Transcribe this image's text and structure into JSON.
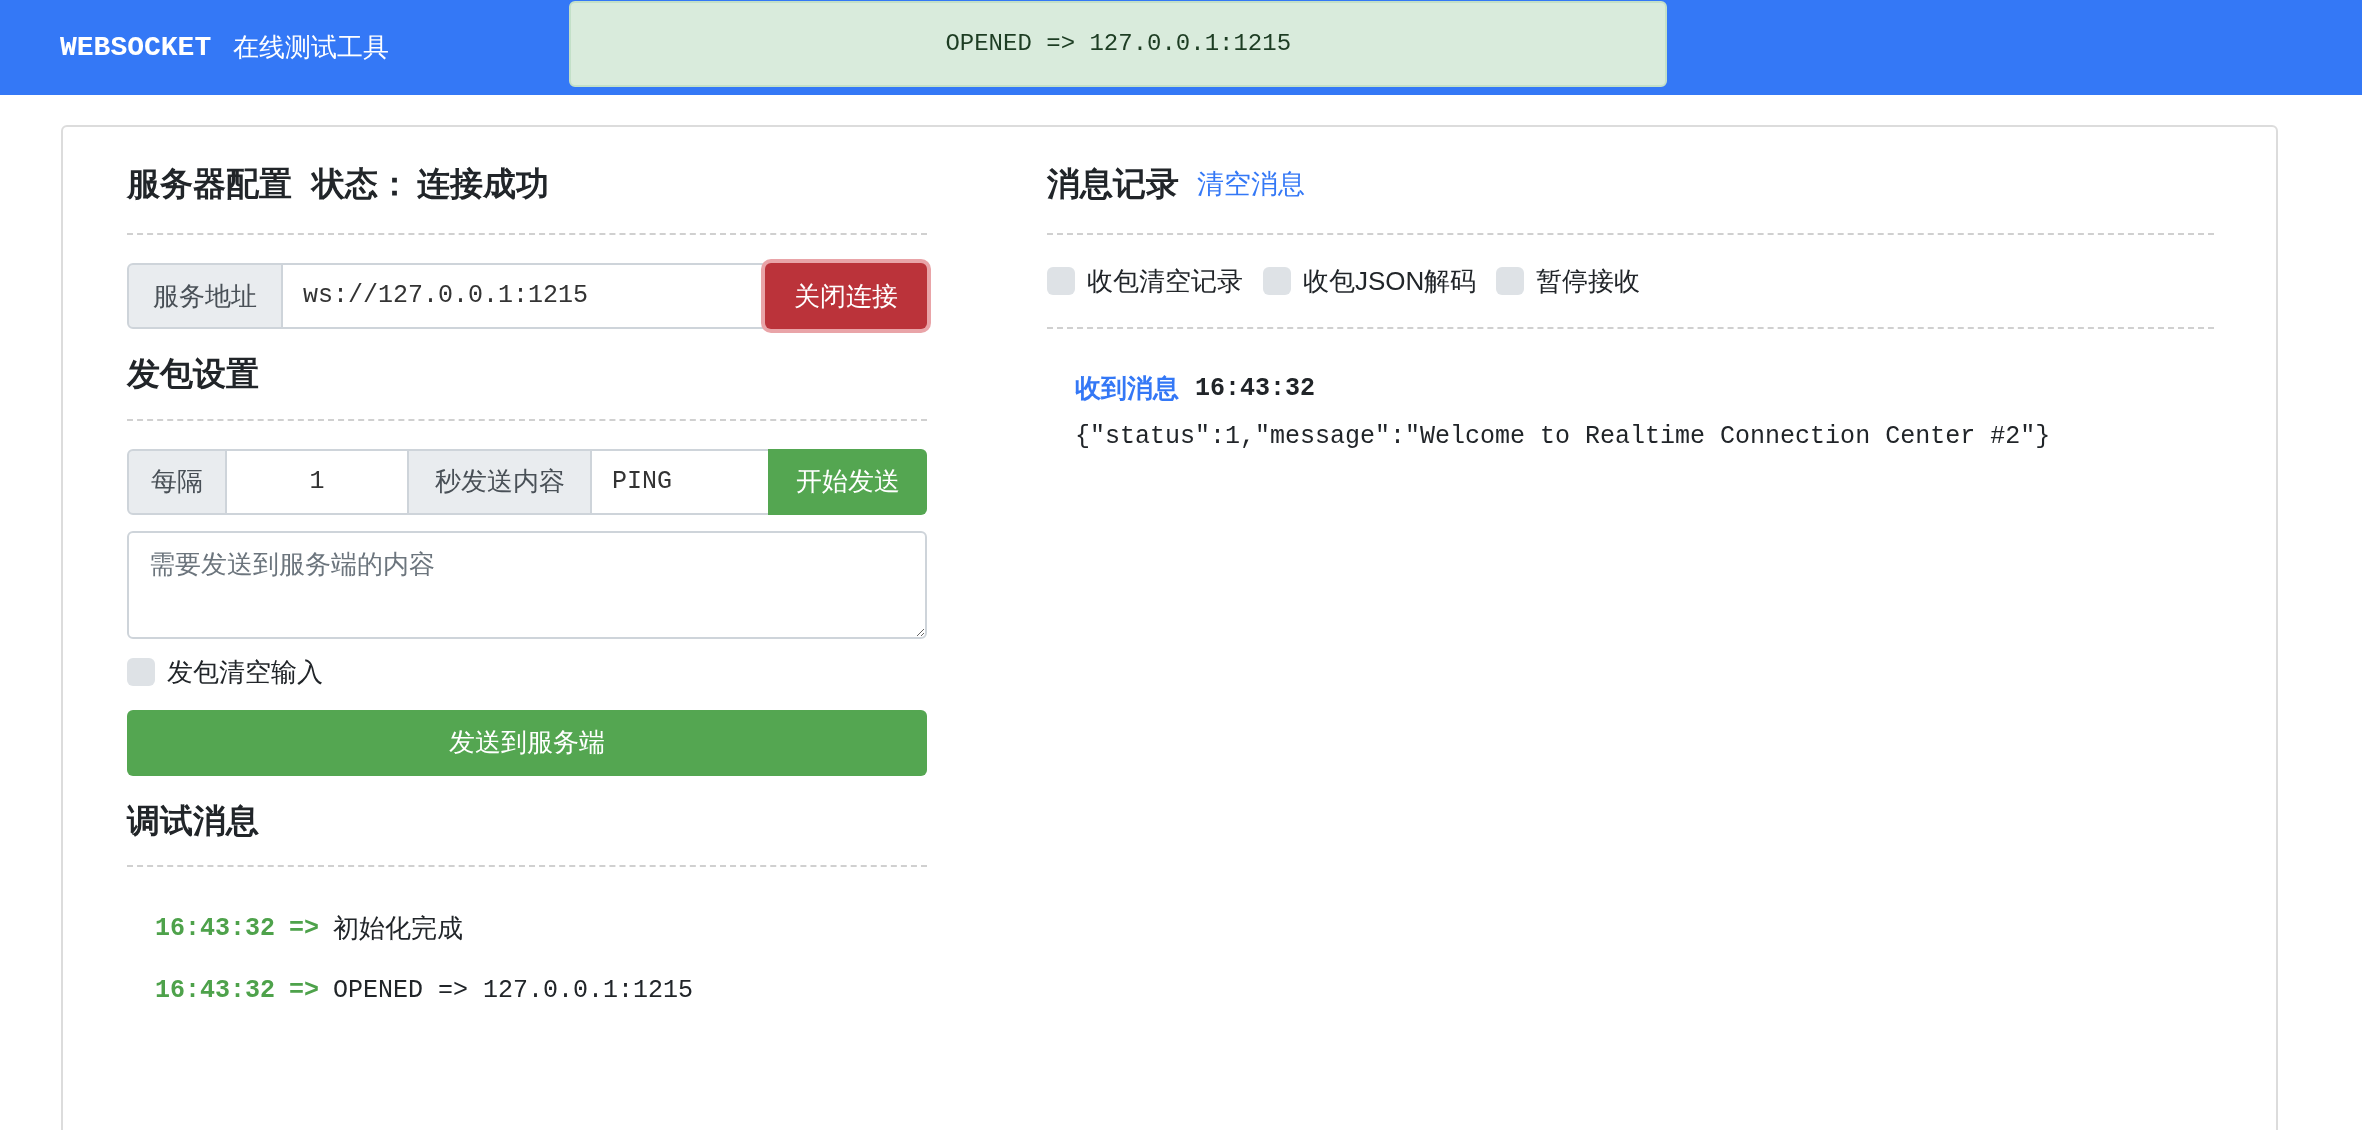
{
  "header": {
    "title_en": "WEBSOCKET",
    "title_cn": "在线测试工具"
  },
  "toast": {
    "text": "OPENED => 127.0.0.1:1215"
  },
  "server": {
    "title": "服务器配置",
    "status_label": "状态：",
    "status_value": "连接成功",
    "address_label": "服务地址",
    "address_value": "ws://127.0.0.1:1215",
    "close_button": "关闭连接"
  },
  "send_settings": {
    "title": "发包设置",
    "interval_label": "每隔",
    "interval_value": "1",
    "content_label": "秒发送内容",
    "content_value": "PING",
    "start_button": "开始发送",
    "textarea_placeholder": "需要发送到服务端的内容",
    "clear_option": {
      "label": "发包清空输入",
      "checked": false
    },
    "send_button": "发送到服务端"
  },
  "debug": {
    "title": "调试消息",
    "entries": [
      {
        "time": "16:43:32",
        "arrow": "=>",
        "text": "初始化完成",
        "kind": "sans"
      },
      {
        "time": "16:43:32",
        "arrow": "=>",
        "text": "OPENED => 127.0.0.1:1215",
        "kind": "mono"
      }
    ]
  },
  "messages": {
    "title": "消息记录",
    "clear_link": "清空消息",
    "options": [
      {
        "label": "收包清空记录",
        "checked": false
      },
      {
        "label": "收包JSON解码",
        "checked": false
      },
      {
        "label": "暂停接收",
        "checked": false
      }
    ],
    "entries": [
      {
        "label": "收到消息",
        "time": "16:43:32",
        "body": "{\"status\":1,\"message\":\"Welcome to Realtime Connection Center #2\"}"
      }
    ]
  }
}
